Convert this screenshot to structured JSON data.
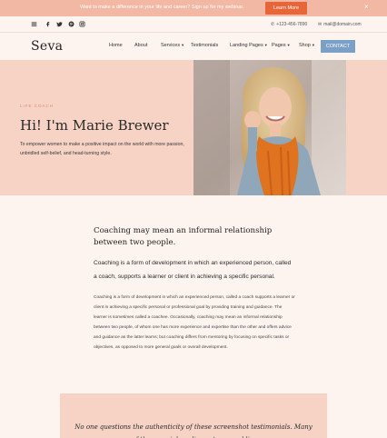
{
  "announcement": {
    "message": "Want to make a difference in your life and career? Sign up for my webinar.",
    "cta_label": "Learn More",
    "close_glyph": "×"
  },
  "utility": {
    "social_icons": [
      "menu-icon",
      "facebook-icon",
      "twitter-icon",
      "pinterest-icon",
      "instagram-icon"
    ],
    "phone": "+123-456-7890",
    "email": "mail@domain.com"
  },
  "nav": {
    "logo": "Seva",
    "items": [
      {
        "label": "Home",
        "dropdown": false
      },
      {
        "label": "About",
        "dropdown": false
      },
      {
        "label": "Services",
        "dropdown": true
      },
      {
        "label": "Testimonials",
        "dropdown": false
      },
      {
        "label": "Landing Pages",
        "dropdown": true
      },
      {
        "label": "Pages",
        "dropdown": true
      },
      {
        "label": "Shop",
        "dropdown": true
      }
    ],
    "caret": "▼",
    "contact_label": "CONTACT"
  },
  "hero": {
    "kicker": "Life coach",
    "title": "Hi! I'm Marie Brewer",
    "lede": "To empower women to make a positive impact on the world with more passion, unbridled self-belief, and head-turning style."
  },
  "content": {
    "heading": "Coaching may mean an informal relationship between two people.",
    "intro": "Coaching is a form of development in which an experienced person, called a coach, supports a learner or client in achieving a specific personal.",
    "body": "Coaching is a form of development in which an experienced person, called a coach supports a learner or client in achieving a specific personal or professional goal by providing training and guidance. The learner is sometimes called a coachee. Occasionally, coaching may mean an informal relationship between two people, of whom one has more experience and expertise than the other and offers advice and guidance as the latter learns; but coaching differs from mentoring by focusing on specific tasks or objectives, as opposed to more general goals or overall development."
  },
  "quote": {
    "text": "No one questions the authenticity of these screenshot testimonials. Many of these social media posts are public."
  },
  "colors": {
    "announcement_bg": "#f2b8a4",
    "cta_bg": "#e6663a",
    "page_bg": "#fdf4f0",
    "hero_bg": "#f6d3c5",
    "contact_bg": "#7aa1c5"
  }
}
